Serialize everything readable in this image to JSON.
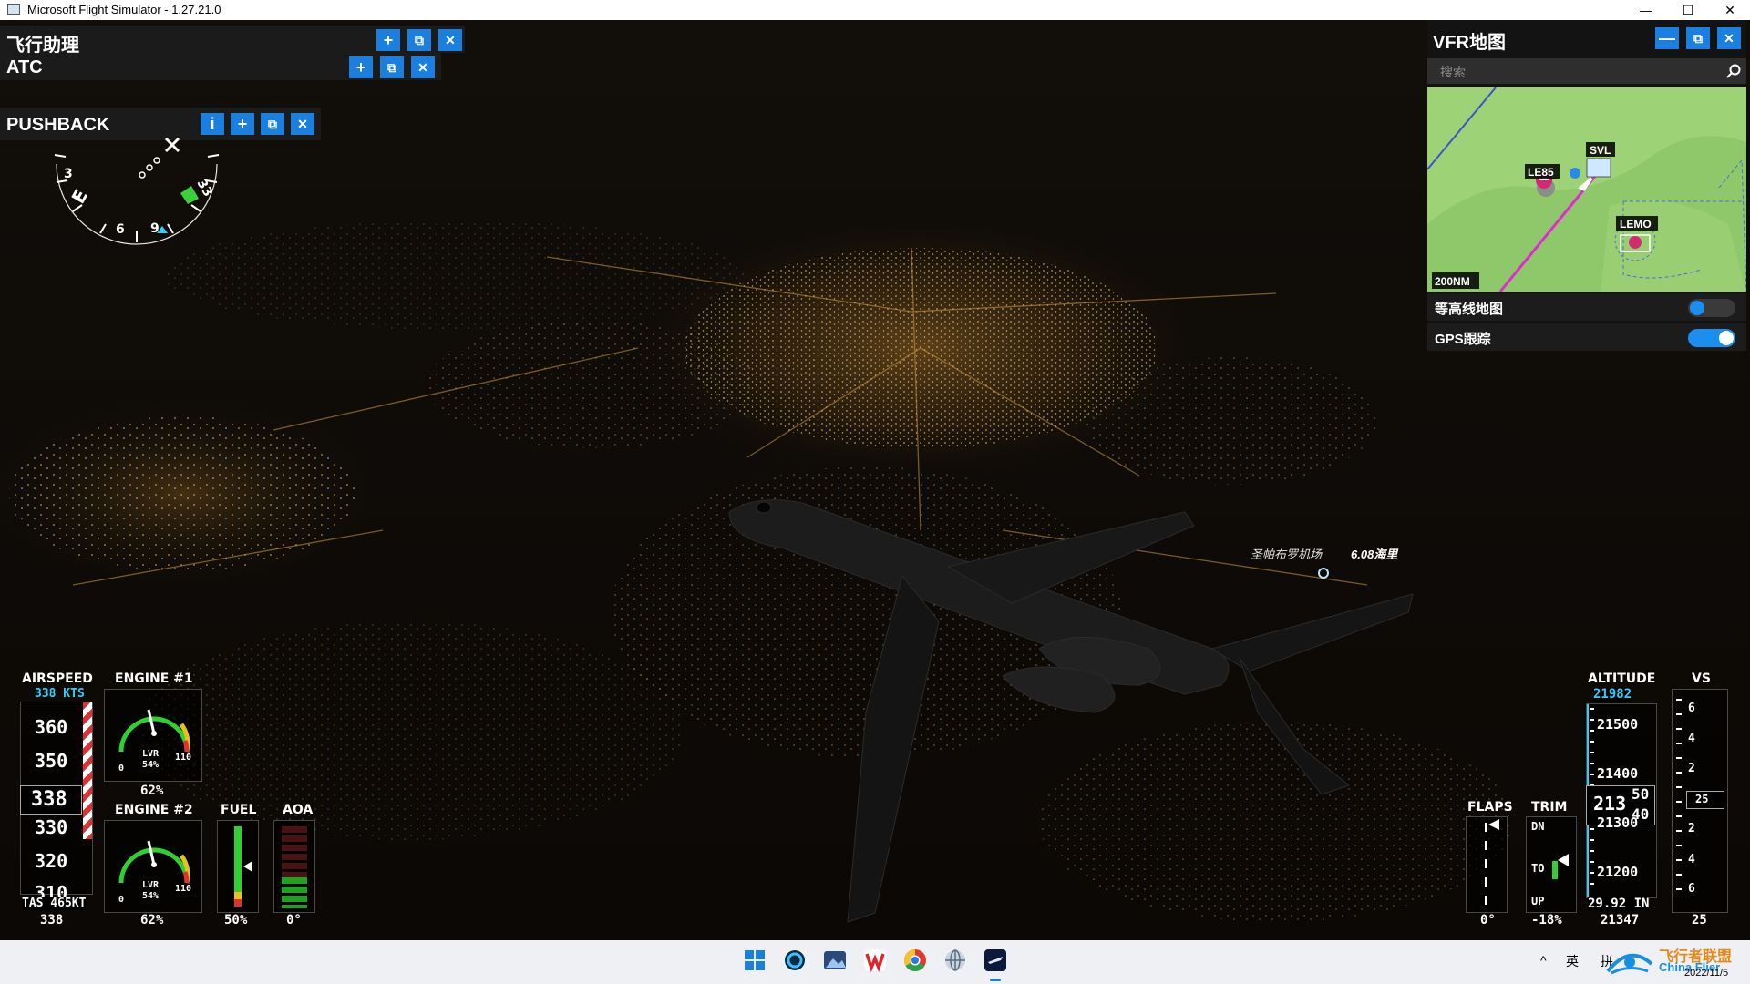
{
  "window": {
    "title": "Microsoft Flight Simulator - 1.27.21.0",
    "minimize_glyph": "—",
    "maximize_glyph": "☐",
    "close_glyph": "✕"
  },
  "panels": {
    "assistant": {
      "title": "飞行助理"
    },
    "atc": {
      "title": "ATC"
    },
    "pushback": {
      "title": "PUSHBACK",
      "info_glyph": "i"
    },
    "button_glyphs": {
      "add": "+",
      "popout": "⧉",
      "close": "✕",
      "minimize": "—"
    }
  },
  "vfr_map": {
    "title": "VFR地图",
    "search_placeholder": "搜索",
    "scale": "200NM",
    "airports": [
      "SVL",
      "LE85",
      "LEMO"
    ],
    "rows": [
      {
        "label": "等高线地图",
        "enabled": false
      },
      {
        "label": "GPS跟踪",
        "enabled": true
      }
    ]
  },
  "compass": {
    "labels": [
      "E",
      "3",
      "6",
      "9",
      "33"
    ]
  },
  "scene": {
    "airport_label": "圣帕布罗机场",
    "distance": "6.08海里"
  },
  "hud": {
    "airspeed": {
      "title": "AIRSPEED",
      "selected": "338 KTS",
      "ticks": [
        "360",
        "350",
        "338",
        "330",
        "320",
        "310"
      ],
      "tas": "TAS 465KT",
      "value": "338"
    },
    "engine1": {
      "title": "ENGINE #1",
      "lvr": "LVR",
      "pct": "54%",
      "min": "0",
      "max": "110",
      "value": "62%"
    },
    "engine2": {
      "title": "ENGINE #2",
      "lvr": "LVR",
      "pct": "54%",
      "min": "0",
      "max": "110",
      "value": "62%"
    },
    "fuel": {
      "title": "FUEL",
      "value": "50%",
      "level": 0.5
    },
    "aoa": {
      "title": "AOA",
      "value": "0°"
    },
    "flaps": {
      "title": "FLAPS",
      "value": "0°"
    },
    "trim": {
      "title": "TRIM",
      "dn": "DN",
      "to": "TO",
      "up": "UP",
      "value": "-18%"
    },
    "altitude": {
      "title": "ALTITUDE",
      "selected": "21982",
      "ticks": [
        "21500",
        "21400",
        "21300",
        "21200"
      ],
      "current_main": "213",
      "current_upper": "50",
      "current_lower": "40",
      "baro": "29.92 IN",
      "value": "21347"
    },
    "vs": {
      "title": "VS",
      "ticks": [
        "6",
        "4",
        "2",
        "2",
        "4",
        "6"
      ],
      "current": "25",
      "value": "25"
    }
  },
  "taskbar": {
    "tray_chevron": "^",
    "ime_lang": "英",
    "ime_mode": "拼",
    "date": "2022/11/5",
    "watermark": "飞行者联盟",
    "watermark_sub": "China Flier"
  }
}
